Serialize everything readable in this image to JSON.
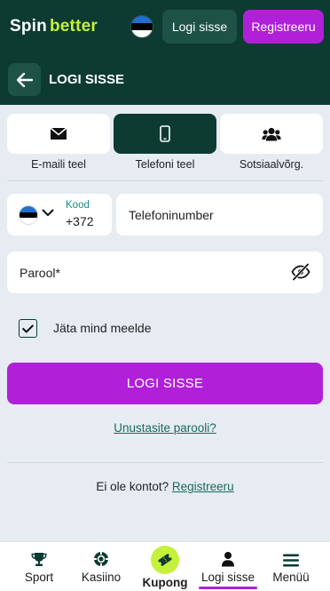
{
  "brand": {
    "logo_part1": "Spin",
    "logo_part2": "better"
  },
  "header": {
    "login_label": "Logi sisse",
    "register_label": "Registreeru",
    "flag": "estonia-flag"
  },
  "page": {
    "title": "LOGI SISSE",
    "back_icon": "arrow-left-icon"
  },
  "methods": [
    {
      "label": "E-maili teel",
      "icon": "envelope-icon",
      "active": false
    },
    {
      "label": "Telefoni teel",
      "icon": "phone-icon",
      "active": true
    },
    {
      "label": "Sotsiaalvõrg.",
      "icon": "users-icon",
      "active": false
    }
  ],
  "form": {
    "country_code_label": "Kood",
    "country_code_value": "+372",
    "phone_placeholder": "Telefoninumber",
    "password_placeholder": "Parool*",
    "remember_label": "Jäta mind meelde",
    "remember_checked": true,
    "submit_label": "LOGI SISSE",
    "forgot_label": "Unustasite parooli?",
    "no_account_text": "Ei ole kontot?",
    "register_link": "Registreeru"
  },
  "bottom_nav": [
    {
      "label": "Sport",
      "icon": "trophy-icon"
    },
    {
      "label": "Kasiino",
      "icon": "casino-chip-icon"
    },
    {
      "label": "Kupong",
      "icon": "ticket-icon"
    },
    {
      "label": "Logi sisse",
      "icon": "user-icon",
      "active": true
    },
    {
      "label": "Menüü",
      "icon": "menu-icon"
    }
  ],
  "colors": {
    "header_bg": "#0d3b31",
    "accent_purple": "#b020d8",
    "accent_lime": "#c6f13a",
    "page_bg": "#e6ecf2"
  }
}
